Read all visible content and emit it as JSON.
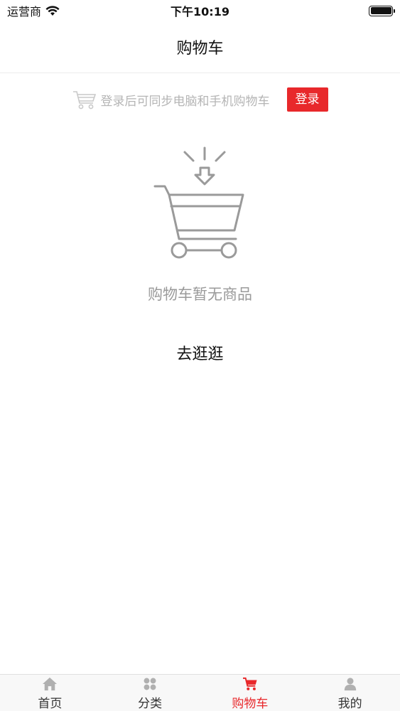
{
  "status_bar": {
    "carrier": "运营商",
    "time": "下午10:19"
  },
  "nav": {
    "title": "购物车"
  },
  "login_banner": {
    "text": "登录后可同步电脑和手机购物车",
    "button_label": "登录"
  },
  "empty_state": {
    "message": "购物车暂无商品",
    "action_label": "去逛逛"
  },
  "tab_bar": {
    "active_color": "#e8282b",
    "tabs": [
      {
        "label": "首页",
        "icon": "home-icon"
      },
      {
        "label": "分类",
        "icon": "category-grid-icon"
      },
      {
        "label": "购物车",
        "icon": "cart-icon",
        "active": true
      },
      {
        "label": "我的",
        "icon": "user-icon"
      }
    ]
  }
}
